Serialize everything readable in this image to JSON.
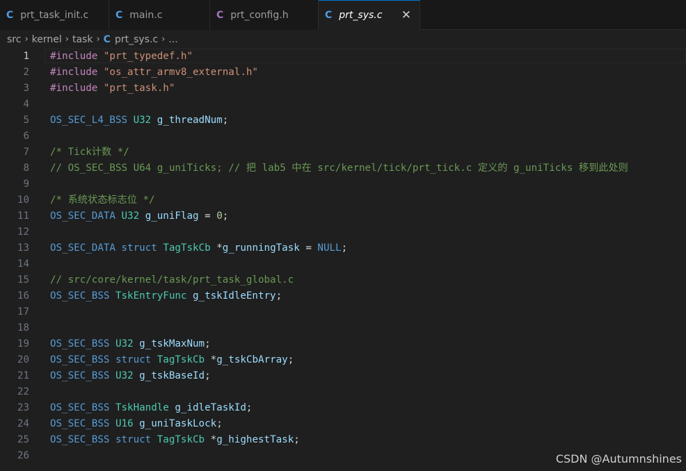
{
  "tabs": [
    {
      "icon": "C",
      "label": "prt_task_init.c",
      "active": false
    },
    {
      "icon": "C",
      "label": "main.c",
      "active": false
    },
    {
      "icon": "C",
      "label": "prt_config.h",
      "active": false
    },
    {
      "icon": "C",
      "label": "prt_sys.c",
      "active": true,
      "close": "✕"
    }
  ],
  "breadcrumb": {
    "parts": [
      "src",
      "kernel",
      "task"
    ],
    "file_icon": "C",
    "file": "prt_sys.c",
    "ellipsis": "...",
    "separator": "›"
  },
  "editor": {
    "current_line": 1,
    "lines": [
      {
        "num": "1",
        "tokens": [
          [
            "kw",
            "#include"
          ],
          [
            "p",
            " "
          ],
          [
            "str",
            "\"prt_typedef.h\""
          ]
        ]
      },
      {
        "num": "2",
        "tokens": [
          [
            "kw",
            "#include"
          ],
          [
            "p",
            " "
          ],
          [
            "str",
            "\"os_attr_armv8_external.h\""
          ]
        ]
      },
      {
        "num": "3",
        "tokens": [
          [
            "kw",
            "#include"
          ],
          [
            "p",
            " "
          ],
          [
            "str",
            "\"prt_task.h\""
          ]
        ]
      },
      {
        "num": "4",
        "tokens": []
      },
      {
        "num": "5",
        "tokens": [
          [
            "mac",
            "OS_SEC_L4_BSS"
          ],
          [
            "p",
            " "
          ],
          [
            "type",
            "U32"
          ],
          [
            "p",
            " "
          ],
          [
            "var",
            "g_threadNum"
          ],
          [
            "p",
            ";"
          ]
        ]
      },
      {
        "num": "6",
        "tokens": []
      },
      {
        "num": "7",
        "tokens": [
          [
            "com",
            "/* Tick计数 */"
          ]
        ]
      },
      {
        "num": "8",
        "tokens": [
          [
            "com",
            "// OS_SEC_BSS U64 g_uniTicks; // 把 lab5 中在 src/kernel/tick/prt_tick.c 定义的 g_uniTicks 移到此处则"
          ]
        ]
      },
      {
        "num": "9",
        "tokens": []
      },
      {
        "num": "10",
        "tokens": [
          [
            "com",
            "/* 系统状态标志位 */"
          ]
        ]
      },
      {
        "num": "11",
        "tokens": [
          [
            "mac",
            "OS_SEC_DATA"
          ],
          [
            "p",
            " "
          ],
          [
            "type",
            "U32"
          ],
          [
            "p",
            " "
          ],
          [
            "var",
            "g_uniFlag"
          ],
          [
            "p",
            " = "
          ],
          [
            "num",
            "0"
          ],
          [
            "p",
            ";"
          ]
        ]
      },
      {
        "num": "12",
        "tokens": []
      },
      {
        "num": "13",
        "tokens": [
          [
            "mac",
            "OS_SEC_DATA"
          ],
          [
            "p",
            " "
          ],
          [
            "ctrl",
            "struct"
          ],
          [
            "p",
            " "
          ],
          [
            "type",
            "TagTskCb"
          ],
          [
            "p",
            " *"
          ],
          [
            "var",
            "g_runningTask"
          ],
          [
            "p",
            " = "
          ],
          [
            "ctrl",
            "NULL"
          ],
          [
            "p",
            ";"
          ]
        ]
      },
      {
        "num": "14",
        "tokens": []
      },
      {
        "num": "15",
        "tokens": [
          [
            "com",
            "// src/core/kernel/task/prt_task_global.c"
          ]
        ]
      },
      {
        "num": "16",
        "tokens": [
          [
            "mac",
            "OS_SEC_BSS"
          ],
          [
            "p",
            " "
          ],
          [
            "type",
            "TskEntryFunc"
          ],
          [
            "p",
            " "
          ],
          [
            "var",
            "g_tskIdleEntry"
          ],
          [
            "p",
            ";"
          ]
        ]
      },
      {
        "num": "17",
        "tokens": []
      },
      {
        "num": "18",
        "tokens": []
      },
      {
        "num": "19",
        "tokens": [
          [
            "mac",
            "OS_SEC_BSS"
          ],
          [
            "p",
            " "
          ],
          [
            "type",
            "U32"
          ],
          [
            "p",
            " "
          ],
          [
            "var",
            "g_tskMaxNum"
          ],
          [
            "p",
            ";"
          ]
        ]
      },
      {
        "num": "20",
        "tokens": [
          [
            "mac",
            "OS_SEC_BSS"
          ],
          [
            "p",
            " "
          ],
          [
            "ctrl",
            "struct"
          ],
          [
            "p",
            " "
          ],
          [
            "type",
            "TagTskCb"
          ],
          [
            "p",
            " *"
          ],
          [
            "var",
            "g_tskCbArray"
          ],
          [
            "p",
            ";"
          ]
        ]
      },
      {
        "num": "21",
        "tokens": [
          [
            "mac",
            "OS_SEC_BSS"
          ],
          [
            "p",
            " "
          ],
          [
            "type",
            "U32"
          ],
          [
            "p",
            " "
          ],
          [
            "var",
            "g_tskBaseId"
          ],
          [
            "p",
            ";"
          ]
        ]
      },
      {
        "num": "22",
        "tokens": []
      },
      {
        "num": "23",
        "tokens": [
          [
            "mac",
            "OS_SEC_BSS"
          ],
          [
            "p",
            " "
          ],
          [
            "type",
            "TskHandle"
          ],
          [
            "p",
            " "
          ],
          [
            "var",
            "g_idleTaskId"
          ],
          [
            "p",
            ";"
          ]
        ]
      },
      {
        "num": "24",
        "tokens": [
          [
            "mac",
            "OS_SEC_BSS"
          ],
          [
            "p",
            " "
          ],
          [
            "type",
            "U16"
          ],
          [
            "p",
            " "
          ],
          [
            "var",
            "g_uniTaskLock"
          ],
          [
            "p",
            ";"
          ]
        ]
      },
      {
        "num": "25",
        "tokens": [
          [
            "mac",
            "OS_SEC_BSS"
          ],
          [
            "p",
            " "
          ],
          [
            "ctrl",
            "struct"
          ],
          [
            "p",
            " "
          ],
          [
            "type",
            "TagTskCb"
          ],
          [
            "p",
            " *"
          ],
          [
            "var",
            "g_highestTask"
          ],
          [
            "p",
            ";"
          ]
        ]
      },
      {
        "num": "26",
        "tokens": []
      }
    ]
  },
  "watermark": "CSDN @Autumnshines",
  "colors": {
    "c_icon": "#4d9de0",
    "h_icon": "#a074c4",
    "accent": "#0078d4"
  }
}
